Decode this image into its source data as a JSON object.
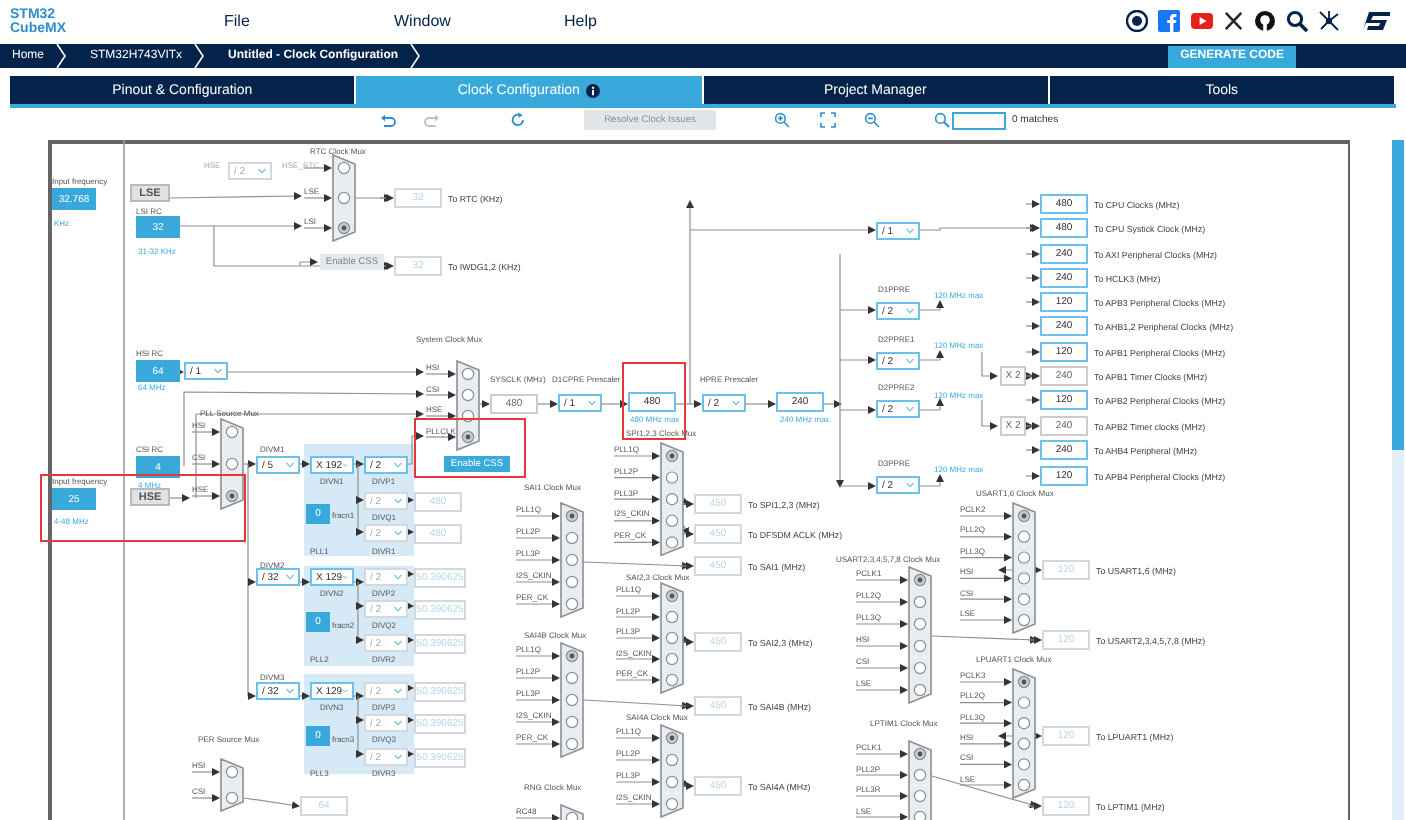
{
  "logo": {
    "top": "STM32",
    "bottom": "CubeMX"
  },
  "menu": [
    "File",
    "Window",
    "Help"
  ],
  "breadcrumbs": [
    "Home",
    "STM32H743VITx",
    "Untitled - Clock Configuration"
  ],
  "generate_button": "GENERATE CODE",
  "tabs": [
    {
      "label": "Pinout & Configuration",
      "selected": false,
      "info": false
    },
    {
      "label": "Clock Configuration",
      "selected": true,
      "info": true
    },
    {
      "label": "Project Manager",
      "selected": false,
      "info": false
    },
    {
      "label": "Tools",
      "selected": false,
      "info": false
    }
  ],
  "toolbar": {
    "resolve_button": {
      "label": "Resolve Clock Issues",
      "disabled": true
    },
    "match_count": "0 matches"
  },
  "diagram": {
    "labels": [
      {
        "text": "Input frequency",
        "kind": "title"
      },
      {
        "text": "KHz",
        "kind": "note"
      },
      {
        "text": "LSI RC",
        "kind": "title"
      },
      {
        "text": "31-32 KHz",
        "kind": "note"
      },
      {
        "text": "HSE",
        "kind": "dim"
      },
      {
        "text": "HSE_RTC",
        "kind": "dim"
      },
      {
        "text": "HSI RC",
        "kind": "title"
      },
      {
        "text": "64 MHz",
        "kind": "note"
      },
      {
        "text": "CSI RC",
        "kind": "title"
      },
      {
        "text": "Input frequency",
        "kind": "title"
      },
      {
        "text": "4 MHz",
        "kind": "note"
      },
      {
        "text": "4-48 MHz",
        "kind": "note"
      },
      {
        "text": "DIVM1",
        "kind": "title"
      },
      {
        "text": "DIVN1",
        "kind": "title"
      },
      {
        "text": "DIVP1",
        "kind": "title"
      },
      {
        "text": "fracn1",
        "kind": "title"
      },
      {
        "text": "DIVQ1",
        "kind": "title"
      },
      {
        "text": "DIVR1",
        "kind": "title"
      },
      {
        "text": "PLL1",
        "kind": "title"
      },
      {
        "text": "DIVM2",
        "kind": "title"
      },
      {
        "text": "DIVN2",
        "kind": "title"
      },
      {
        "text": "DIVP2",
        "kind": "title"
      },
      {
        "text": "fracn2",
        "kind": "title"
      },
      {
        "text": "DIVQ2",
        "kind": "title"
      },
      {
        "text": "DIVR2",
        "kind": "title"
      },
      {
        "text": "PLL2",
        "kind": "title"
      },
      {
        "text": "DIVM3",
        "kind": "title"
      },
      {
        "text": "DIVN3",
        "kind": "title"
      },
      {
        "text": "DIVP3",
        "kind": "title"
      },
      {
        "text": "fracn3",
        "kind": "title"
      },
      {
        "text": "DIVQ3",
        "kind": "title"
      },
      {
        "text": "DIVR3",
        "kind": "title"
      },
      {
        "text": "PLL3",
        "kind": "title"
      },
      {
        "text": "SYSCLK (MHz)",
        "kind": "title"
      },
      {
        "text": "D1CPRE Prescaler",
        "kind": "title"
      },
      {
        "text": "480 MHz max",
        "kind": "note"
      },
      {
        "text": "HPRE Prescaler",
        "kind": "title"
      },
      {
        "text": "240 MHz max",
        "kind": "note"
      },
      {
        "text": "D1PPRE",
        "kind": "title"
      },
      {
        "text": "D2PPRE1",
        "kind": "title"
      },
      {
        "text": "D2PPRE2",
        "kind": "title"
      },
      {
        "text": "D3PPRE",
        "kind": "title"
      },
      {
        "text": "120 MHz max",
        "kind": "note"
      },
      {
        "text": "120 MHz max",
        "kind": "note"
      },
      {
        "text": "120 MHz max",
        "kind": "note"
      },
      {
        "text": "120 MHz max",
        "kind": "note"
      }
    ],
    "oscillators": [
      {
        "label": "LSE"
      },
      {
        "label": "HSE"
      }
    ],
    "css_buttons": [
      {
        "label": "Enable CSS",
        "disabled": true
      },
      {
        "label": "Enable CSS",
        "disabled": false
      }
    ],
    "pll_panels": [
      {
        "kind": "pll"
      },
      {
        "kind": "pll"
      },
      {
        "kind": "pll"
      }
    ],
    "value_boxes": [
      {
        "value": "32.768",
        "kind": "input"
      },
      {
        "value": "32",
        "kind": "input"
      },
      {
        "value": "64",
        "kind": "input"
      },
      {
        "value": "4",
        "kind": "input"
      },
      {
        "value": "25",
        "kind": "input"
      },
      {
        "value": "0",
        "kind": "input"
      },
      {
        "value": "0",
        "kind": "input"
      },
      {
        "value": "0",
        "kind": "input"
      },
      {
        "value": "32",
        "kind": "inactive",
        "target": "To RTC (KHz)"
      },
      {
        "value": "32",
        "kind": "inactive",
        "target": "To IWDG1,2 (KHz)"
      },
      {
        "value": "480",
        "kind": "inactive"
      },
      {
        "value": "480",
        "kind": "inactive"
      },
      {
        "value": "50.390625",
        "kind": "inactive"
      },
      {
        "value": "50.390625",
        "kind": "inactive"
      },
      {
        "value": "50.390625",
        "kind": "inactive"
      },
      {
        "value": "50.390625",
        "kind": "inactive"
      },
      {
        "value": "50.390625",
        "kind": "inactive"
      },
      {
        "value": "50.390625",
        "kind": "inactive"
      },
      {
        "value": "64",
        "kind": "inactive"
      },
      {
        "value": "480",
        "kind": "plain"
      },
      {
        "value": "480",
        "kind": "output"
      },
      {
        "value": "240",
        "kind": "output"
      },
      {
        "value": "450",
        "kind": "inactive",
        "target": "To SPI1,2,3 (MHz)"
      },
      {
        "value": "450",
        "kind": "inactive",
        "target": "To DFSDM ACLK (MHz)"
      },
      {
        "value": "450",
        "kind": "inactive",
        "target": "To SAI1 (MHz)"
      },
      {
        "value": "450",
        "kind": "inactive",
        "target": "To SAI2,3 (MHz)"
      },
      {
        "value": "450",
        "kind": "inactive",
        "target": "To SAI4B (MHz)"
      },
      {
        "value": "450",
        "kind": "inactive",
        "target": "To SAI4A (MHz)"
      },
      {
        "value": "480",
        "kind": "output",
        "target": "To CPU Clocks (MHz)"
      },
      {
        "value": "480",
        "kind": "output",
        "target": "To CPU Systick Clock (MHz)"
      },
      {
        "value": "240",
        "kind": "output",
        "target": "To AXI Peripheral Clocks (MHz)"
      },
      {
        "value": "240",
        "kind": "output",
        "target": "To HCLK3 (MHz)"
      },
      {
        "value": "120",
        "kind": "output",
        "target": "To APB3 Peripheral Clocks (MHz)"
      },
      {
        "value": "240",
        "kind": "output",
        "target": "To AHB1,2 Peripheral Clocks (MHz)"
      },
      {
        "value": "120",
        "kind": "output",
        "target": "To APB1 Peripheral Clocks (MHz)"
      },
      {
        "value": "240",
        "kind": "plain",
        "target": "To APB1 Timer Clocks (MHz)"
      },
      {
        "value": "120",
        "kind": "output",
        "target": "To APB2 Peripheral Clocks (MHz)"
      },
      {
        "value": "240",
        "kind": "plain",
        "target": "To APB2 Timer clocks (MHz)"
      },
      {
        "value": "240",
        "kind": "output",
        "target": "To AHB4 Peripheral (MHz)"
      },
      {
        "value": "120",
        "kind": "output",
        "target": "To APB4 Peripheral Clocks (MHz)"
      },
      {
        "value": "X 2",
        "kind": "plain"
      },
      {
        "value": "X 2",
        "kind": "plain"
      },
      {
        "value": "120",
        "kind": "inactive",
        "target": "To USART1,6 (MHz)"
      },
      {
        "value": "120",
        "kind": "inactive",
        "target": "To USART2,3,4,5,7,8 (MHz)"
      },
      {
        "value": "120",
        "kind": "inactive",
        "target": "To LPUART1 (MHz)"
      },
      {
        "value": "120",
        "kind": "inactive",
        "target": "To LPTIM1 (MHz)"
      }
    ],
    "dropdowns": [
      {
        "value": "/ 2",
        "disabled": true
      },
      {
        "value": "/ 1",
        "disabled": false
      },
      {
        "value": "/ 5",
        "disabled": false
      },
      {
        "value": "X 192",
        "disabled": false
      },
      {
        "value": "/ 2",
        "disabled": false
      },
      {
        "value": "/ 2",
        "disabled": true
      },
      {
        "value": "/ 2",
        "disabled": true
      },
      {
        "value": "/ 32",
        "disabled": false
      },
      {
        "value": "X 129",
        "disabled": false
      },
      {
        "value": "/ 2",
        "disabled": true
      },
      {
        "value": "/ 2",
        "disabled": true
      },
      {
        "value": "/ 2",
        "disabled": true
      },
      {
        "value": "/ 32",
        "disabled": false
      },
      {
        "value": "X 129",
        "disabled": false
      },
      {
        "value": "/ 2",
        "disabled": true
      },
      {
        "value": "/ 2",
        "disabled": true
      },
      {
        "value": "/ 2",
        "disabled": true
      },
      {
        "value": "/ 1",
        "disabled": false
      },
      {
        "value": "/ 2",
        "disabled": false
      },
      {
        "value": "/ 1",
        "disabled": false
      },
      {
        "value": "/ 2",
        "disabled": false
      },
      {
        "value": "/ 2",
        "disabled": false
      },
      {
        "value": "/ 2",
        "disabled": false
      },
      {
        "value": "/ 2",
        "disabled": false
      }
    ],
    "muxes": [
      {
        "title": "RTC Clock Mux",
        "inputs": [
          {
            "selected": false
          },
          {
            "label": "LSE",
            "selected": false
          },
          {
            "label": "LSI",
            "selected": true
          }
        ]
      },
      {
        "title": "System Clock Mux",
        "inputs": [
          {
            "label": "HSI",
            "selected": false
          },
          {
            "label": "CSI",
            "selected": false
          },
          {
            "label": "HSE",
            "selected": false
          },
          {
            "label": "PLLCLK",
            "selected": true
          }
        ]
      },
      {
        "title": "PLL Source Mux",
        "inputs": [
          {
            "label": "HSI",
            "selected": false
          },
          {
            "label": "CSI",
            "selected": false
          },
          {
            "label": "HSE",
            "selected": true
          }
        ]
      },
      {
        "title": "SPI1,2,3 Clock Mux",
        "inputs": [
          {
            "label": "PLL1Q",
            "selected": true
          },
          {
            "label": "PLL2P",
            "selected": false
          },
          {
            "label": "PLL3P",
            "selected": false
          },
          {
            "label": "I2S_CKIN",
            "selected": false
          },
          {
            "label": "PER_CK",
            "selected": false
          }
        ]
      },
      {
        "title": "SAI1 Clock Mux",
        "inputs": [
          {
            "label": "PLL1Q",
            "selected": true
          },
          {
            "label": "PLL2P",
            "selected": false
          },
          {
            "label": "PLL3P",
            "selected": false
          },
          {
            "label": "I2S_CKIN",
            "selected": false
          },
          {
            "label": "PER_CK",
            "selected": false
          }
        ]
      },
      {
        "title": "SAI2,3 Clock Mux",
        "inputs": [
          {
            "label": "PLL1Q",
            "selected": true
          },
          {
            "label": "PLL2P",
            "selected": false
          },
          {
            "label": "PLL3P",
            "selected": false
          },
          {
            "label": "I2S_CKIN",
            "selected": false
          },
          {
            "label": "PER_CK",
            "selected": false
          }
        ]
      },
      {
        "title": "SAI4B Clock Mux",
        "inputs": [
          {
            "label": "PLL1Q",
            "selected": true
          },
          {
            "label": "PLL2P",
            "selected": false
          },
          {
            "label": "PLL3P",
            "selected": false
          },
          {
            "label": "I2S_CKIN",
            "selected": false
          },
          {
            "label": "PER_CK",
            "selected": false
          }
        ]
      },
      {
        "title": "SAI4A Clock Mux",
        "inputs": [
          {
            "label": "PLL1Q",
            "selected": true
          },
          {
            "label": "PLL2P",
            "selected": false
          },
          {
            "label": "PLL3P",
            "selected": false
          },
          {
            "label": "I2S_CKIN",
            "selected": false
          }
        ]
      },
      {
        "title": "RNG Clock Mux",
        "inputs": [
          {
            "label": "RC48",
            "selected": false
          }
        ]
      },
      {
        "title": "USART2,3,4,5,7,8 Clock Mux",
        "inputs": [
          {
            "label": "PCLK1",
            "selected": true
          },
          {
            "label": "PLL2Q",
            "selected": false
          },
          {
            "label": "PLL3Q",
            "selected": false
          },
          {
            "label": "HSI",
            "selected": false
          },
          {
            "label": "CSI",
            "selected": false
          },
          {
            "label": "LSE",
            "selected": false
          }
        ]
      },
      {
        "title": "LPTIM1 Clock Mux",
        "inputs": [
          {
            "label": "PCLK1",
            "selected": true
          },
          {
            "label": "PLL2P",
            "selected": false
          },
          {
            "label": "PLL3R",
            "selected": false
          },
          {
            "label": "LSE",
            "selected": false
          }
        ]
      },
      {
        "title": "USART1,6 Clock Mux",
        "inputs": [
          {
            "label": "PCLK2",
            "selected": true
          },
          {
            "label": "PLL2Q",
            "selected": false
          },
          {
            "label": "PLL3Q",
            "selected": false
          },
          {
            "label": "HSI",
            "selected": false
          },
          {
            "label": "CSI",
            "selected": false
          },
          {
            "label": "LSE",
            "selected": false
          }
        ]
      },
      {
        "title": "LPUART1 Clock Mux",
        "inputs": [
          {
            "label": "PCLK3",
            "selected": true
          },
          {
            "label": "PLL2Q",
            "selected": false
          },
          {
            "label": "PLL3Q",
            "selected": false
          },
          {
            "label": "HSI",
            "selected": false
          },
          {
            "label": "CSI",
            "selected": false
          },
          {
            "label": "LSE",
            "selected": false
          }
        ]
      },
      {
        "title": "PER Source Mux",
        "inputs": [
          {
            "label": "HSI",
            "selected": false
          },
          {
            "label": "CSI",
            "selected": false
          }
        ]
      }
    ],
    "highlights": [
      {
        "kind": "hse-source"
      },
      {
        "kind": "sysclk-select"
      },
      {
        "kind": "cpu-clock"
      }
    ]
  }
}
